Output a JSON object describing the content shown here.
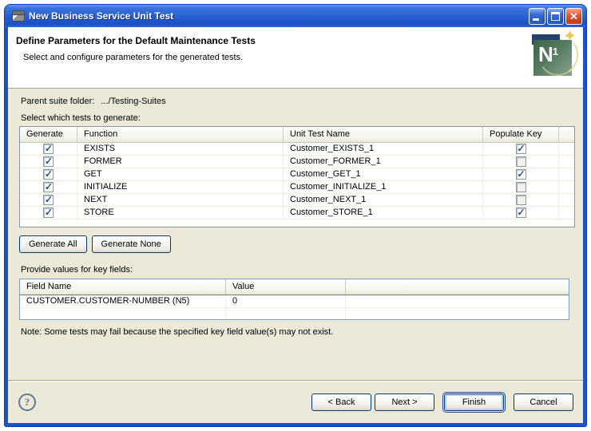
{
  "window": {
    "title": "New Business Service Unit Test"
  },
  "header": {
    "title": "Define Parameters for the Default Maintenance Tests",
    "subtitle": "Select and configure parameters for the generated tests.",
    "icon_letter": "N",
    "icon_sup": "1"
  },
  "labels": {
    "parent_suite_label": "Parent suite folder:",
    "parent_suite_value": ".../Testing-Suites",
    "select_tests": "Select which tests to generate:",
    "provide_values": "Provide values for key fields:",
    "note": "Note: Some tests may fail because the specified key field value(s) may not exist."
  },
  "tests_table": {
    "columns": [
      "Generate",
      "Function",
      "Unit Test Name",
      "Populate Key"
    ],
    "rows": [
      {
        "generate": true,
        "function": "EXISTS",
        "unit_test_name": "Customer_EXISTS_1",
        "populate_key": true
      },
      {
        "generate": true,
        "function": "FORMER",
        "unit_test_name": "Customer_FORMER_1",
        "populate_key": false
      },
      {
        "generate": true,
        "function": "GET",
        "unit_test_name": "Customer_GET_1",
        "populate_key": true
      },
      {
        "generate": true,
        "function": "INITIALIZE",
        "unit_test_name": "Customer_INITIALIZE_1",
        "populate_key": false
      },
      {
        "generate": true,
        "function": "NEXT",
        "unit_test_name": "Customer_NEXT_1",
        "populate_key": false
      },
      {
        "generate": true,
        "function": "STORE",
        "unit_test_name": "Customer_STORE_1",
        "populate_key": true
      }
    ]
  },
  "generate_buttons": {
    "all": "Generate All",
    "none": "Generate None"
  },
  "key_fields_table": {
    "columns": [
      "Field Name",
      "Value"
    ],
    "rows": [
      {
        "field_name": "CUSTOMER.CUSTOMER-NUMBER (N5)",
        "value": "0"
      }
    ]
  },
  "footer": {
    "help": "?",
    "back": "< Back",
    "next": "Next >",
    "finish": "Finish",
    "cancel": "Cancel"
  },
  "icons": {
    "close": "✕",
    "star": "✦"
  },
  "colors": {
    "titlebar_blue": "#2a62d4",
    "window_border": "#1d53c9",
    "close_red": "#cc3a1c",
    "dialog_bg": "#ece9d8",
    "check_navy": "#2b4f9e",
    "icon_green": "#557a60",
    "icon_navy": "#24416a",
    "icon_gold": "#f0c447",
    "table_border": "#7f9db9"
  }
}
